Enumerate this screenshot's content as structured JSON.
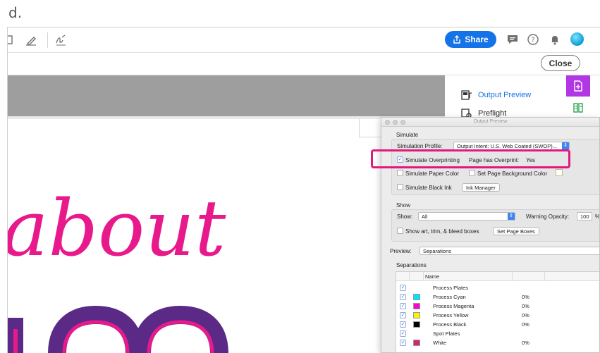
{
  "step_label": "d.",
  "toolbar": {
    "share_label": "Share"
  },
  "subbar": {
    "close_label": "Close"
  },
  "artwork": {
    "script_text": "about"
  },
  "right_panel": {
    "items": [
      {
        "label": "Output Preview",
        "icon": "output-preview-icon"
      },
      {
        "label": "Preflight",
        "icon": "preflight-icon"
      }
    ]
  },
  "dialog": {
    "title": "Output Preview",
    "simulate_heading": "Simulate",
    "simulation_profile_label": "Simulation Profile:",
    "simulation_profile_value": "Output Intent: U.S. Web Coated (SWOP)...",
    "simulate_overprinting_label": "Simulate Overprinting",
    "simulate_overprinting_checked": true,
    "page_overprint_label": "Page has Overprint:",
    "page_overprint_value": "Yes",
    "simulate_paper_color_label": "Simulate Paper Color",
    "set_page_bg_label": "Set Page Background Color",
    "simulate_black_ink_label": "Simulate Black Ink",
    "ink_manager_label": "Ink Manager",
    "show_heading": "Show",
    "show_label": "Show:",
    "show_value": "All",
    "warning_opacity_label": "Warning Opacity:",
    "warning_opacity_value": "100",
    "warning_opacity_unit": "%",
    "show_boxes_label": "Show art, trim, & bleed boxes",
    "set_page_boxes_label": "Set Page Boxes",
    "preview_label": "Preview:",
    "preview_value": "Separations",
    "separations_heading": "Separations",
    "table_header_name": "Name",
    "separations": [
      {
        "name": "Process Plates",
        "swatch": null,
        "percent": ""
      },
      {
        "name": "Process Cyan",
        "swatch": "#00e5ff",
        "percent": "0%"
      },
      {
        "name": "Process Magenta",
        "swatch": "#ff00d0",
        "percent": "0%"
      },
      {
        "name": "Process Yellow",
        "swatch": "#fff200",
        "percent": "0%"
      },
      {
        "name": "Process Black",
        "swatch": "#000000",
        "percent": "0%"
      },
      {
        "name": "Spot Plates",
        "swatch": null,
        "percent": ""
      },
      {
        "name": "White",
        "swatch": "#d4246e",
        "percent": "0%"
      }
    ]
  },
  "colors": {
    "share_blue": "#1473e6",
    "highlight_magenta": "#e3187f",
    "rail_purple": "#b136e4",
    "script_pink": "#e8198b"
  }
}
